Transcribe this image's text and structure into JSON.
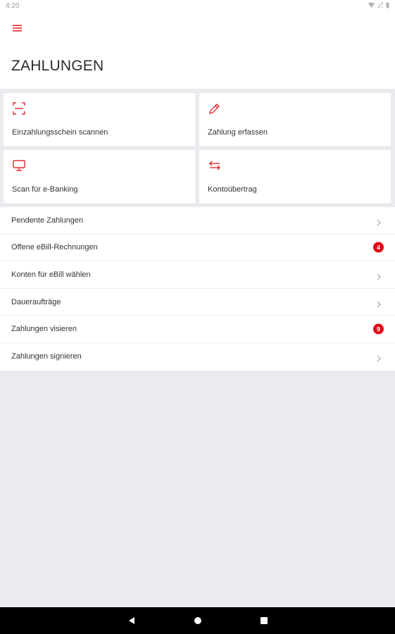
{
  "status_bar": {
    "time": "4:20"
  },
  "header": {
    "title": "ZAHLUNGEN",
    "menu_icon": "hamburger-menu-icon"
  },
  "colors": {
    "accent": "#e30613",
    "badge": "#e30613",
    "background": "#eaebee",
    "nav_bar": "#000000"
  },
  "tiles": [
    {
      "label": "Einzahlungsschein scannen",
      "icon": "scan-frame-icon"
    },
    {
      "label": "Zahlung erfassen",
      "icon": "pencil-icon"
    },
    {
      "label": "Scan für e-Banking",
      "icon": "monitor-icon"
    },
    {
      "label": "Kontoübertrag",
      "icon": "transfer-arrows-icon"
    }
  ],
  "list": [
    {
      "label": "Pendente Zahlungen",
      "badge": null
    },
    {
      "label": "Offene eBill-Rechnungen",
      "badge": "4"
    },
    {
      "label": "Konten für eBill wählen",
      "badge": null
    },
    {
      "label": "Daueraufträge",
      "badge": null
    },
    {
      "label": "Zahlungen visieren",
      "badge": "9"
    },
    {
      "label": "Zahlungen signieren",
      "badge": null
    }
  ],
  "nav": {
    "back_icon": "back-triangle-icon",
    "home_icon": "home-circle-icon",
    "recents_icon": "recents-square-icon"
  }
}
